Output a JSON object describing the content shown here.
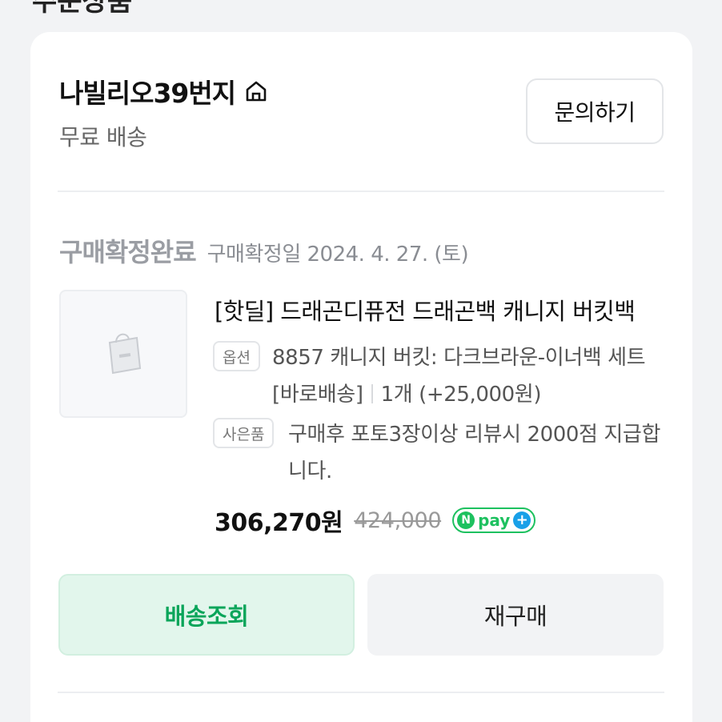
{
  "header": {
    "partial_title": "주문상품"
  },
  "store": {
    "name": "나빌리오39번지",
    "home_icon": "home-icon",
    "shipping": "무료 배송",
    "inquiry_button": "문의하기"
  },
  "order": {
    "status": "구매확정완료",
    "confirm_date": "구매확정일 2024. 4. 27. (토)"
  },
  "product": {
    "thumbnail_icon": "shopping-bag-icon",
    "title": "[핫딜] 드래곤디퓨전 드래곤백 캐니지 버킷백",
    "option_tag": "옵션",
    "option_text": "8857 캐니지 버킷: 다크브라운-이너백 세트 [바로배송]",
    "quantity": "1개 (+25,000원)",
    "gift_tag": "사은품",
    "gift_text": "구매후 포토3장이상 리뷰시 2000점 지급합니다.",
    "price": "306,270원",
    "original_price": "424,000",
    "npay_label": "pay"
  },
  "actions": {
    "track_button": "배송조회",
    "rebuy_button": "재구매"
  },
  "colors": {
    "accent_green": "#0aa55a",
    "track_bg": "#e2f6ec",
    "npay_green": "#1dc15f"
  }
}
